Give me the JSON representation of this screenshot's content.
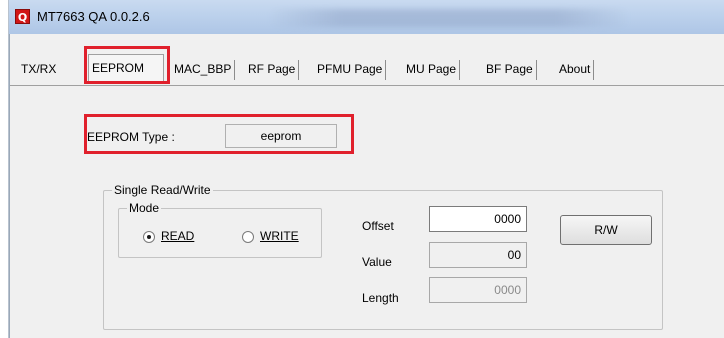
{
  "window": {
    "title": "MT7663 QA 0.0.2.6",
    "icon_letter": "Q"
  },
  "tabs": [
    {
      "label": "TX/RX"
    },
    {
      "label": "EEPROM",
      "active": true
    },
    {
      "label": "MAC_BBP"
    },
    {
      "label": "RF Page"
    },
    {
      "label": "PFMU Page"
    },
    {
      "label": "MU Page"
    },
    {
      "label": "BF Page"
    },
    {
      "label": "About"
    }
  ],
  "eeprom_type": {
    "label": "EEPROM Type :",
    "value": "eeprom"
  },
  "single_rw": {
    "group_label": "Single Read/Write",
    "mode": {
      "group_label": "Mode",
      "read": {
        "label": "READ",
        "checked": true
      },
      "write": {
        "label": "WRITE",
        "checked": false
      }
    },
    "offset": {
      "label": "Offset",
      "value": "0000"
    },
    "value": {
      "label": "Value",
      "value": "00"
    },
    "length": {
      "label": "Length",
      "value": "0000"
    },
    "rw_button": "R/W"
  },
  "colors": {
    "highlight": "#e0202c",
    "app_icon": "#d11616"
  }
}
